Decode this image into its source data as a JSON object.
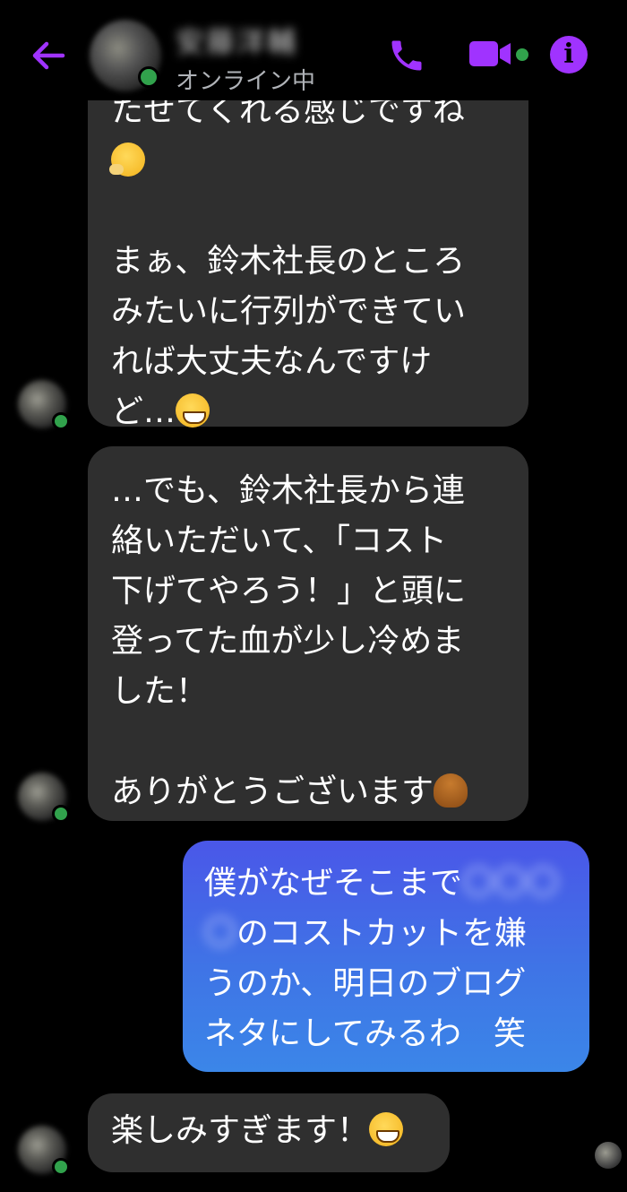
{
  "header": {
    "contact_name": "安藤洋輔",
    "status": "オンライン中",
    "back_icon": "arrow-left-icon",
    "call_icon": "phone-icon",
    "video_icon": "video-camera-icon",
    "info_icon": "info-icon",
    "info_glyph": "i",
    "accent_color": "#a033ff"
  },
  "messages": [
    {
      "from": "them",
      "lines": [
        "たせてくれる感じですね",
        "",
        "まぁ、鈴木社長のところ",
        "みたいに行列ができてい",
        "れば大丈夫なんですけ",
        "ど…"
      ],
      "emoji_1": "thinking-face-emoji",
      "emoji_2": "grinning-face-emoji"
    },
    {
      "from": "them",
      "lines": [
        "…でも、鈴木社長から連",
        "絡いただいて、「コスト",
        "下げてやろう！」と頭に",
        "登ってた血が少し冷めま",
        "した！",
        "",
        "ありがとうございます"
      ],
      "emoji": "person-bowing-emoji"
    },
    {
      "from": "me",
      "line1_a": "僕がなぜそこまで",
      "line1_blur": "〇〇〇",
      "line2_blur": "〇",
      "line2_b": "のコストカットを嫌",
      "line3": "うのか、明日のブログ",
      "line4": "ネタにしてみるわ　笑"
    },
    {
      "from": "them",
      "text": "楽しみすぎます！",
      "emoji": "grinning-face-emoji"
    }
  ],
  "colors": {
    "background": "#000000",
    "incoming_bubble": "#2f2f2f",
    "outgoing_bubble_top": "#4a57e8",
    "outgoing_bubble_bottom": "#3b86e8",
    "online_dot": "#31a24c"
  }
}
